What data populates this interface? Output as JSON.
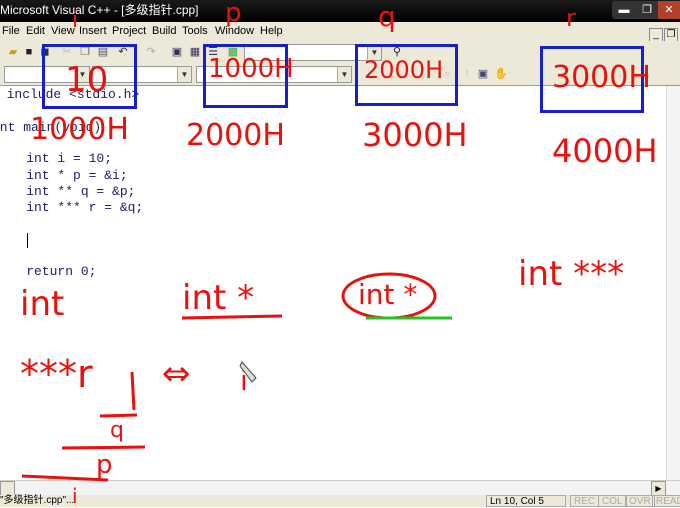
{
  "window": {
    "title": "Microsoft Visual C++ - [多级指针.cpp]",
    "controls": {
      "minimize": "▬",
      "restore": "❐",
      "close": "✕"
    }
  },
  "menubar": {
    "items": [
      "File",
      "Edit",
      "View",
      "Insert",
      "Project",
      "Build",
      "Tools",
      "Window",
      "Help"
    ],
    "mdi_controls": [
      "_",
      "❐"
    ]
  },
  "toolbar": {
    "icons": [
      "open-icon",
      "save-icon",
      "save-all-icon",
      "cut-icon",
      "copy-icon",
      "paste-icon",
      "undo-icon",
      "redo-icon",
      "workspace-icon",
      "output-icon",
      "window-list-icon",
      "find-in-files-icon",
      "find-icon"
    ],
    "find_combo_value": ""
  },
  "editor": {
    "lines": [
      "# include <stdio.h>",
      "int main(void)",
      "",
      "    int i = 10;",
      "    int * p = &i;",
      "    int ** q = &p;",
      "    int *** r = &q;",
      "",
      "    ",
      "",
      "    return 0;"
    ]
  },
  "annotations": {
    "var_labels": [
      "i",
      "p",
      "q",
      "r"
    ],
    "box_values": [
      "10",
      "1000H",
      "2000H",
      "3000H"
    ],
    "addresses": [
      "1000H",
      "2000H",
      "3000H",
      "4000H"
    ],
    "types": [
      "int",
      "int *",
      "int *",
      "int ***"
    ],
    "equivalence": [
      "***r",
      "⇔",
      "i"
    ],
    "derivation": [
      "q",
      "p",
      "i"
    ],
    "colors": {
      "ink": "#e8120c",
      "box": "#1520c8",
      "highlight": "#22c422"
    }
  },
  "statusbar": {
    "left": "\"多级指针.cpp\"...",
    "position": "Ln 10, Col 5",
    "indicators": [
      "REC",
      "COL",
      "OVR",
      "READ"
    ]
  }
}
